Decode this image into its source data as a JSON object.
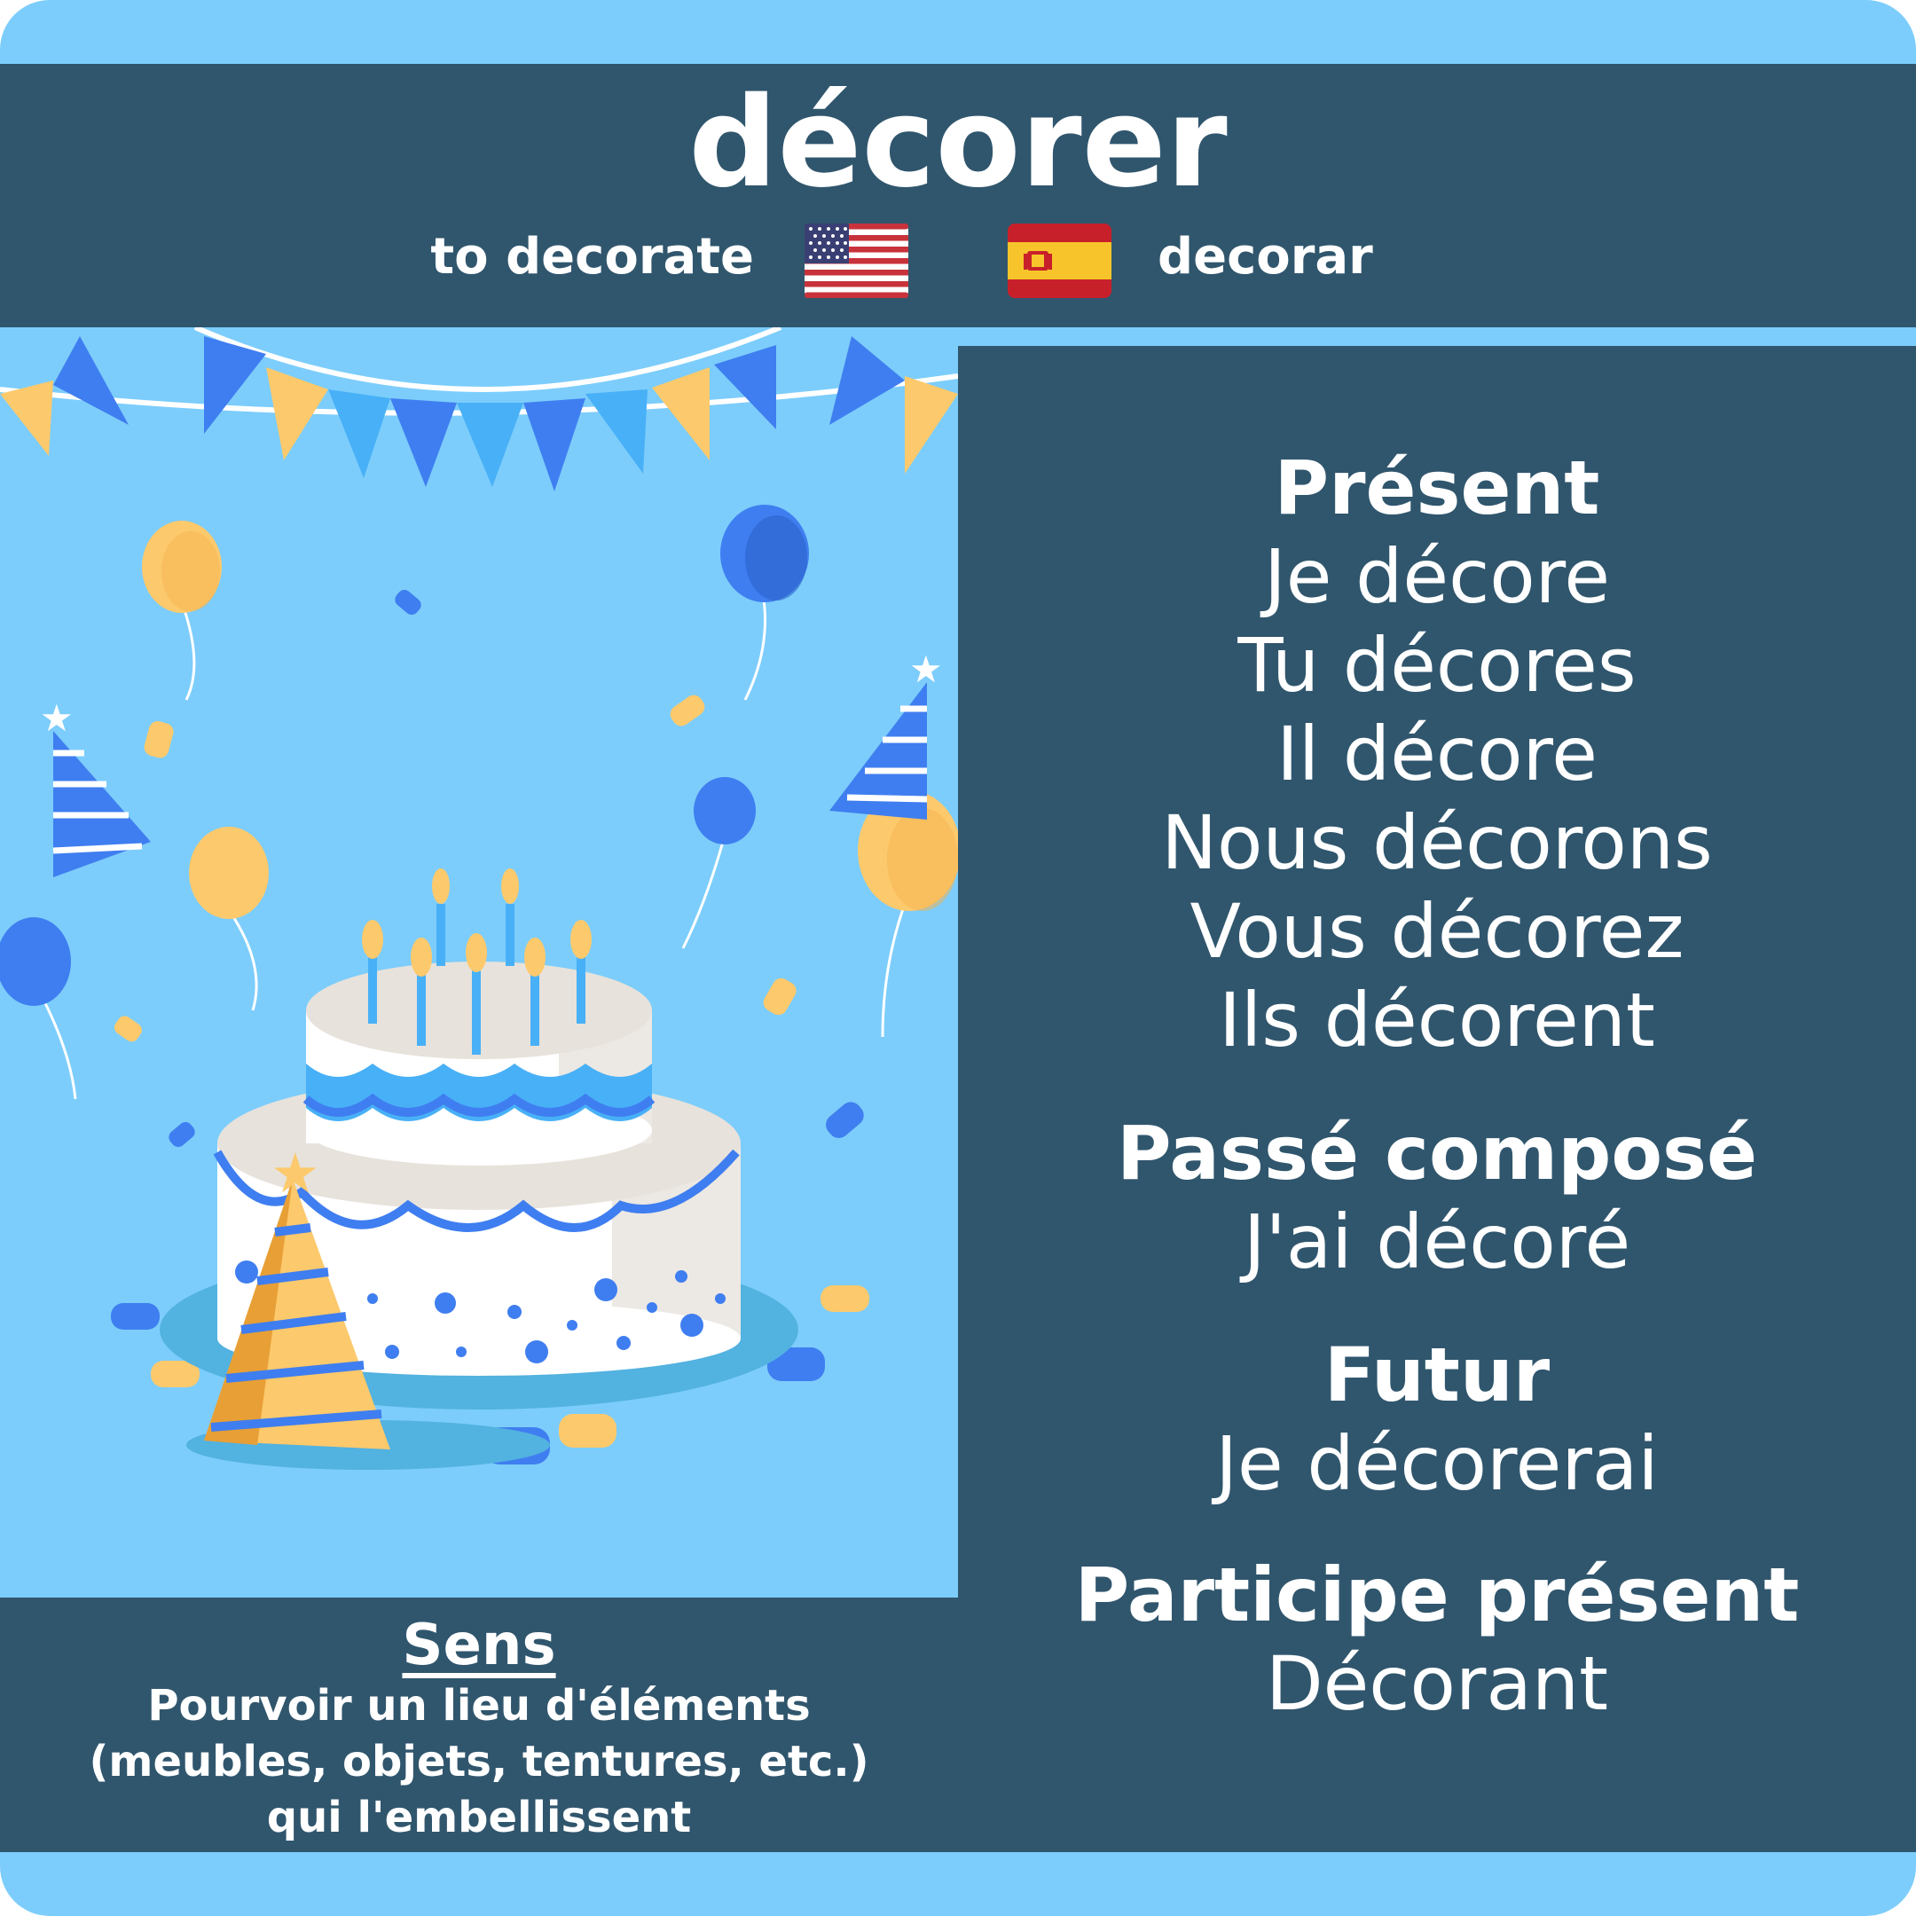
{
  "verb": {
    "title": "décorer",
    "english": "to decorate",
    "spanish": "decorar"
  },
  "flags": {
    "english_flag": "us-flag-icon",
    "spanish_flag": "spain-flag-icon"
  },
  "conjugation": {
    "present": {
      "heading": "Présent",
      "forms": [
        "Je décore",
        "Tu décores",
        "Il décore",
        "Nous décorons",
        "Vous décorez",
        "Ils décorent"
      ]
    },
    "passe_compose": {
      "heading": "Passé composé",
      "form": "J'ai décoré"
    },
    "futur": {
      "heading": "Futur",
      "form": "Je décorerai"
    },
    "participe_present": {
      "heading": "Participe présent",
      "form": "Décorant"
    }
  },
  "meaning": {
    "heading": "Sens",
    "text": "Pourvoir un lieu d'éléments\n(meubles, objets, tentures, etc.)\nqui l'embellissent"
  },
  "colors": {
    "background": "#7ccdfb",
    "panel": "#30566d",
    "text": "#ffffff",
    "accent_blue": "#3f7ef0",
    "accent_yellow": "#fcc96c"
  }
}
